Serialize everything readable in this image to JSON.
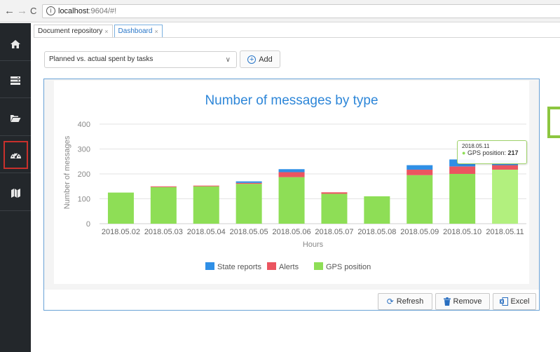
{
  "browser": {
    "back": "←",
    "forward": "→",
    "reload": "C",
    "info": "i",
    "url_host": "localhost",
    "url_path": ":9604/#!"
  },
  "sidebar": {
    "items": [
      {
        "icon": "home-icon",
        "active": false
      },
      {
        "icon": "server-icon",
        "active": false
      },
      {
        "icon": "folder-open-icon",
        "active": false
      },
      {
        "icon": "dashboard-gauge-icon",
        "active": true
      },
      {
        "icon": "map-icon",
        "active": false
      }
    ]
  },
  "tabs": [
    {
      "label": "Document repository",
      "close": "×",
      "active": false
    },
    {
      "label": "Dashboard",
      "close": "×",
      "active": true
    }
  ],
  "report_select": {
    "value": "Planned vs. actual spent by tasks"
  },
  "add_button": {
    "label": "Add"
  },
  "panel_buttons": {
    "refresh": "Refresh",
    "remove": "Remove",
    "excel": "Excel"
  },
  "tooltip": {
    "date": "2018.05.11",
    "series": "GPS position:",
    "value": "217"
  },
  "colors": {
    "state_reports": "#2f8fe6",
    "alerts": "#eb5560",
    "gps_position": "#8ede56",
    "gps_highlight": "#b2f07e",
    "title": "#2d86d8",
    "active_outline": "#c9302c"
  },
  "chart_data": {
    "type": "bar",
    "stacked": true,
    "title": "Number of messages by type",
    "xlabel": "Hours",
    "ylabel": "Number of messages",
    "ylim": [
      0,
      400
    ],
    "yticks": [
      0,
      100,
      200,
      300,
      400
    ],
    "categories": [
      "2018.05.02",
      "2018.05.03",
      "2018.05.04",
      "2018.05.05",
      "2018.05.06",
      "2018.05.07",
      "2018.05.08",
      "2018.05.09",
      "2018.05.10",
      "2018.05.11"
    ],
    "series": [
      {
        "name": "GPS position",
        "values": [
          125,
          147,
          150,
          160,
          187,
          120,
          110,
          195,
          200,
          217
        ]
      },
      {
        "name": "Alerts",
        "values": [
          0,
          3,
          3,
          4,
          20,
          6,
          0,
          22,
          30,
          18
        ]
      },
      {
        "name": "State reports",
        "values": [
          0,
          0,
          0,
          6,
          12,
          0,
          0,
          18,
          28,
          20
        ]
      }
    ],
    "legend": [
      "State reports",
      "Alerts",
      "GPS position"
    ],
    "legend_position": "bottom"
  }
}
